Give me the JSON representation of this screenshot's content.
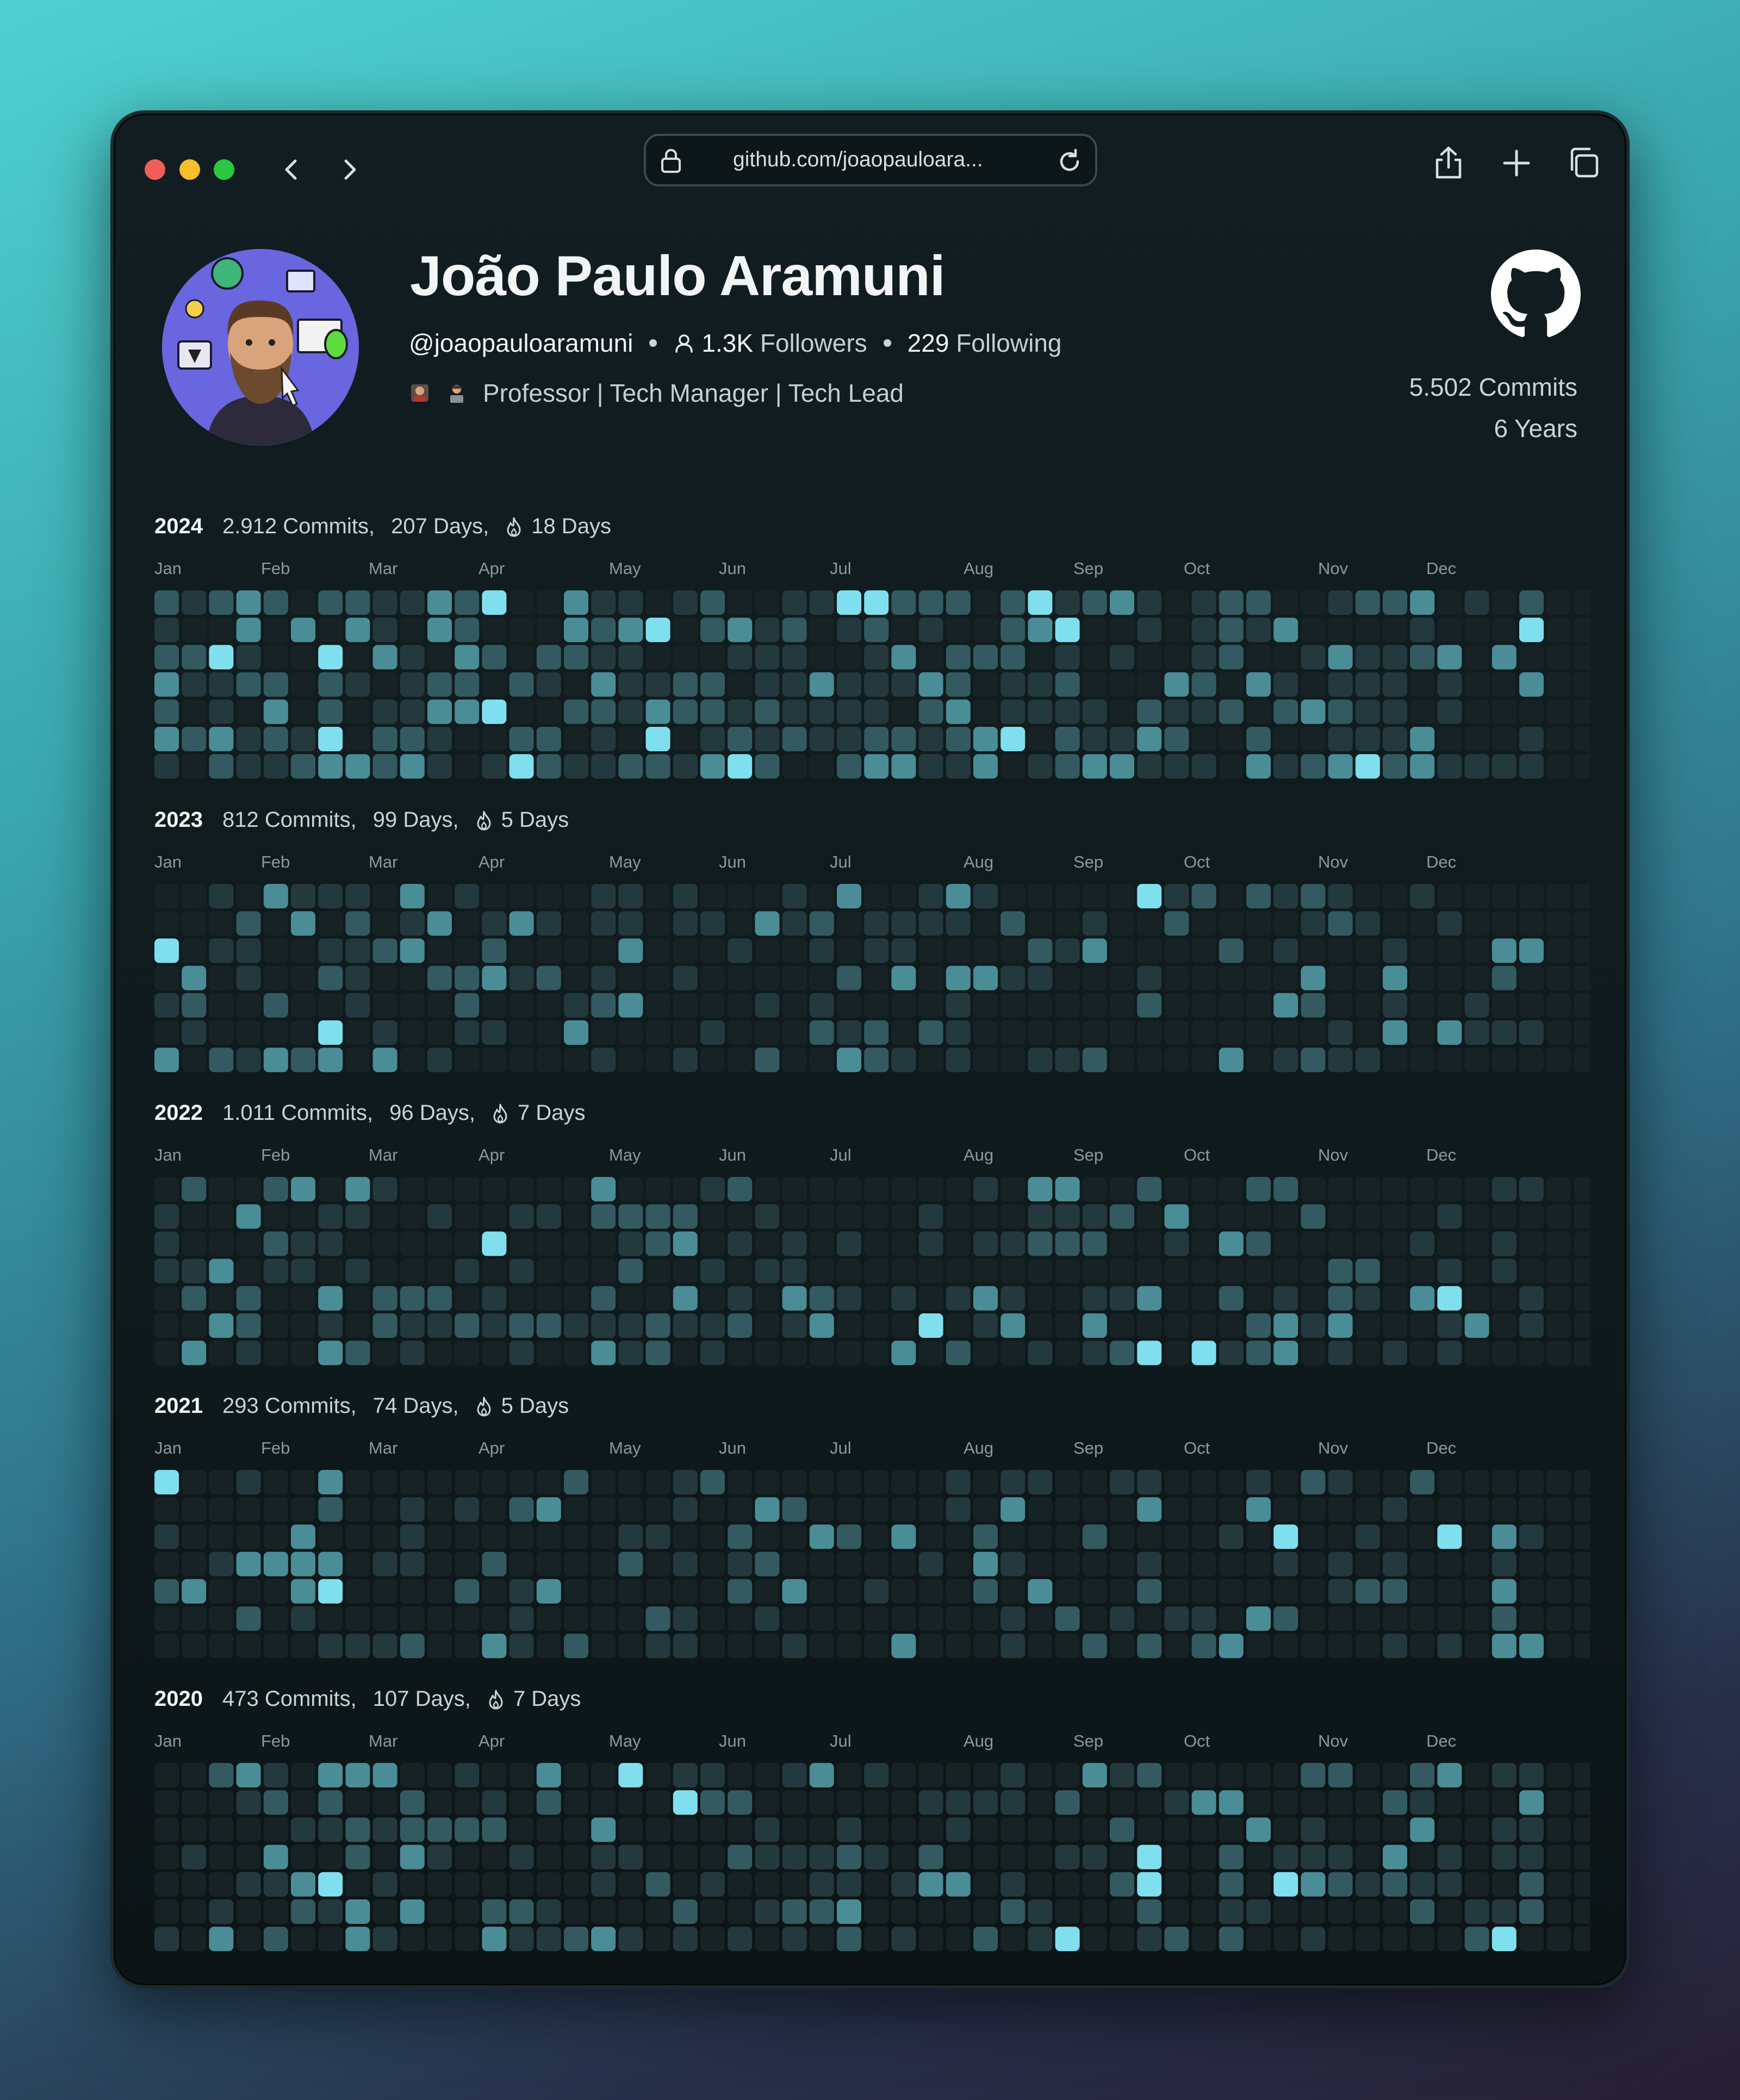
{
  "browser": {
    "url": "github.com/joaopauloara...",
    "traffic_lights": [
      "close",
      "minimize",
      "zoom"
    ],
    "nav_icons": [
      "chevron-left-icon",
      "chevron-right-icon"
    ],
    "toolbar_icons": [
      "share-icon",
      "plus-icon",
      "tabs-icon"
    ]
  },
  "profile": {
    "name": "João Paulo Aramuni",
    "handle": "@joaopauloaramuni",
    "followers_count": "1.3K",
    "followers_label": "Followers",
    "following_count": "229",
    "following_label": "Following",
    "bio": "Professor | Tech Manager | Tech Lead"
  },
  "summary": {
    "commits": "5.502 Commits",
    "years": "6 Years"
  },
  "months": [
    "Jan",
    "Feb",
    "Mar",
    "Apr",
    "May",
    "Jun",
    "Jul",
    "Aug",
    "Sep",
    "Oct",
    "Nov",
    "Dec"
  ],
  "colors": {
    "empty": "#172225",
    "level1": "#24393d",
    "level2": "#335a60",
    "level3": "#4a8d96",
    "level4": "#7fdfee"
  },
  "years": [
    {
      "year": "2024",
      "commits": "2.912 Commits,",
      "days": "207 Days,",
      "streak": "18 Days"
    },
    {
      "year": "2023",
      "commits": "812 Commits,",
      "days": "99 Days,",
      "streak": "5 Days"
    },
    {
      "year": "2022",
      "commits": "1.011 Commits,",
      "days": "96 Days,",
      "streak": "7 Days"
    },
    {
      "year": "2021",
      "commits": "293 Commits,",
      "days": "74 Days,",
      "streak": "5 Days"
    },
    {
      "year": "2020",
      "commits": "473 Commits,",
      "days": "107 Days,",
      "streak": "7 Days"
    }
  ]
}
